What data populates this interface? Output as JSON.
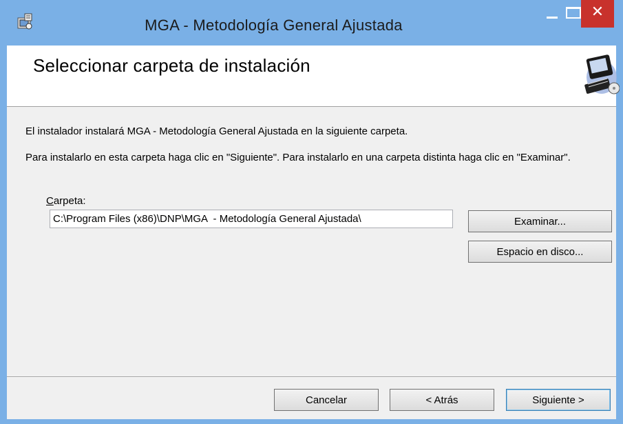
{
  "window": {
    "title": "MGA  - Metodología General Ajustada",
    "close_glyph": "✕",
    "icons": [
      "installer-icon",
      "minimize-icon",
      "maximize-icon",
      "close-icon"
    ]
  },
  "header": {
    "title": "Seleccionar carpeta de instalación",
    "art_icon": "computer-disc-icon"
  },
  "body": {
    "intro": "El instalador instalará MGA  - Metodología General Ajustada en la siguiente carpeta.",
    "instructions": "Para instalarlo en esta carpeta haga clic en \"Siguiente\". Para instalarlo en una carpeta distinta haga clic en \"Examinar\".",
    "folder_label_mnemonic": "C",
    "folder_label_rest": "arpeta:",
    "folder_path": "C:\\Program Files (x86)\\DNP\\MGA  - Metodología General Ajustada\\",
    "browse_label": "Examinar...",
    "disk_space_label": "Espacio en disco..."
  },
  "footer": {
    "cancel_label": "Cancelar",
    "back_label": "< Atrás",
    "next_label": "Siguiente >"
  },
  "colors": {
    "titlebar": "#7ab0e6",
    "close_button": "#c8322c",
    "dialog_background": "#f0f0f0",
    "banner_background": "#ffffff"
  }
}
